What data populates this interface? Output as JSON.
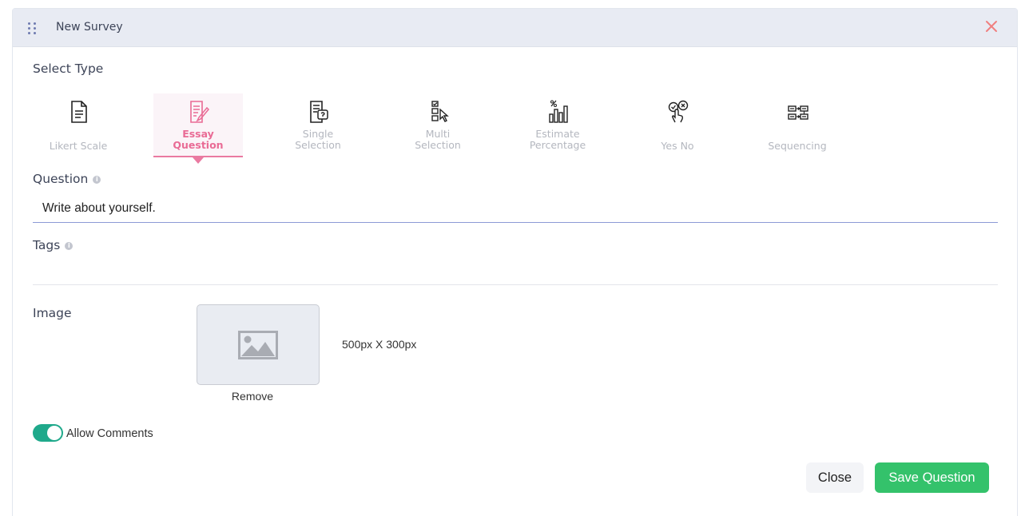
{
  "header": {
    "title": "New Survey",
    "drag_icon": "drag-handle-icon",
    "close_icon": "close-icon",
    "close_color": "#f07f7f"
  },
  "select_type": {
    "label": "Select Type",
    "types": [
      {
        "line1": "Likert Scale",
        "line2": "",
        "icon": "document-icon",
        "active": false
      },
      {
        "line1": "Essay",
        "line2": "Question",
        "icon": "essay-edit-icon",
        "active": true
      },
      {
        "line1": "Single",
        "line2": "Selection",
        "icon": "single-selection-icon",
        "active": false
      },
      {
        "line1": "Multi",
        "line2": "Selection",
        "icon": "multi-selection-icon",
        "active": false
      },
      {
        "line1": "Estimate",
        "line2": "Percentage",
        "icon": "percentage-chart-icon",
        "active": false
      },
      {
        "line1": "Yes No",
        "line2": "",
        "icon": "yes-no-icon",
        "active": false
      },
      {
        "line1": "Sequencing",
        "line2": "",
        "icon": "sequencing-icon",
        "active": false
      }
    ]
  },
  "question": {
    "label": "Question",
    "value": "Write about yourself."
  },
  "tags": {
    "label": "Tags",
    "value": ""
  },
  "image": {
    "label": "Image",
    "placeholder_icon": "image-placeholder-icon",
    "size_text": "500px X 300px",
    "remove_label": "Remove"
  },
  "comments": {
    "label": "Allow Comments",
    "enabled": true
  },
  "actions": {
    "close_label": "Close",
    "save_label": "Save Question"
  },
  "colors": {
    "accent_pink": "#e96b95",
    "toggle_green": "#1fa98b",
    "save_green": "#34c26b",
    "header_bg": "#e8ebf3"
  }
}
